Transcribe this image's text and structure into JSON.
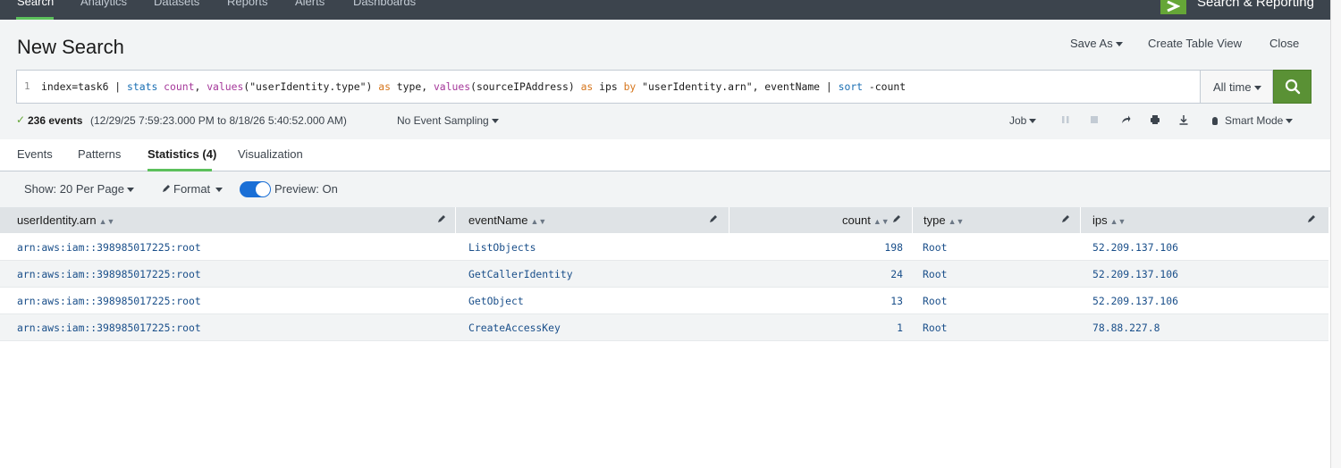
{
  "nav": {
    "tabs": [
      "Search",
      "Analytics",
      "Datasets",
      "Reports",
      "Alerts",
      "Dashboards"
    ],
    "active_tab": "Search",
    "app_title": "Search & Reporting"
  },
  "header": {
    "title": "New Search",
    "save_as": "Save As",
    "create_table_view": "Create Table View",
    "close": "Close"
  },
  "search": {
    "line_number": "1",
    "query_parts": {
      "p1": "index=task6 | ",
      "p2": "stats",
      "p3": " ",
      "p4": "count",
      "p5": ", ",
      "p6": "values",
      "p7": "(\"userIdentity.type\") ",
      "p8": "as",
      "p9": " type, ",
      "p10": "values",
      "p11": "(sourceIPAddress) ",
      "p12": "as",
      "p13": " ips ",
      "p14": "by",
      "p15": " \"userIdentity.arn\", eventName | ",
      "p16": "sort",
      "p17": " -count"
    },
    "time_range": "All time"
  },
  "status": {
    "event_count": "236 events",
    "range": "(12/29/25 7:59:23.000 PM to 8/18/26 5:40:52.000 AM)",
    "sampling": "No Event Sampling",
    "job": "Job",
    "mode": "Smart Mode"
  },
  "result_tabs": {
    "events": "Events",
    "patterns": "Patterns",
    "statistics": "Statistics (4)",
    "visualization": "Visualization"
  },
  "toolbar": {
    "show": "Show: 20 Per Page",
    "format": "Format",
    "preview": "Preview: On",
    "preview_on": true
  },
  "table": {
    "columns": [
      "userIdentity.arn",
      "eventName",
      "count",
      "type",
      "ips"
    ],
    "rows": [
      [
        "arn:aws:iam::398985017225:root",
        "ListObjects",
        "198",
        "Root",
        "52.209.137.106"
      ],
      [
        "arn:aws:iam::398985017225:root",
        "GetCallerIdentity",
        "24",
        "Root",
        "52.209.137.106"
      ],
      [
        "arn:aws:iam::398985017225:root",
        "GetObject",
        "13",
        "Root",
        "52.209.137.106"
      ],
      [
        "arn:aws:iam::398985017225:root",
        "CreateAccessKey",
        "1",
        "Root",
        "78.88.227.8"
      ]
    ]
  },
  "colors": {
    "nav_bg": "#3c444d",
    "accent_green": "#5cc05c",
    "search_button": "#5a9135",
    "toggle_blue": "#1a6fd6",
    "link_blue": "#1a4f8a"
  },
  "icons": {
    "search_button": "search-icon",
    "pause": "pause-icon",
    "stop": "stop-icon",
    "share": "share-icon",
    "print": "print-icon",
    "export": "download-icon",
    "mode": "lightbulb-icon",
    "format": "pencil-icon",
    "column_edit": "pencil-icon"
  }
}
